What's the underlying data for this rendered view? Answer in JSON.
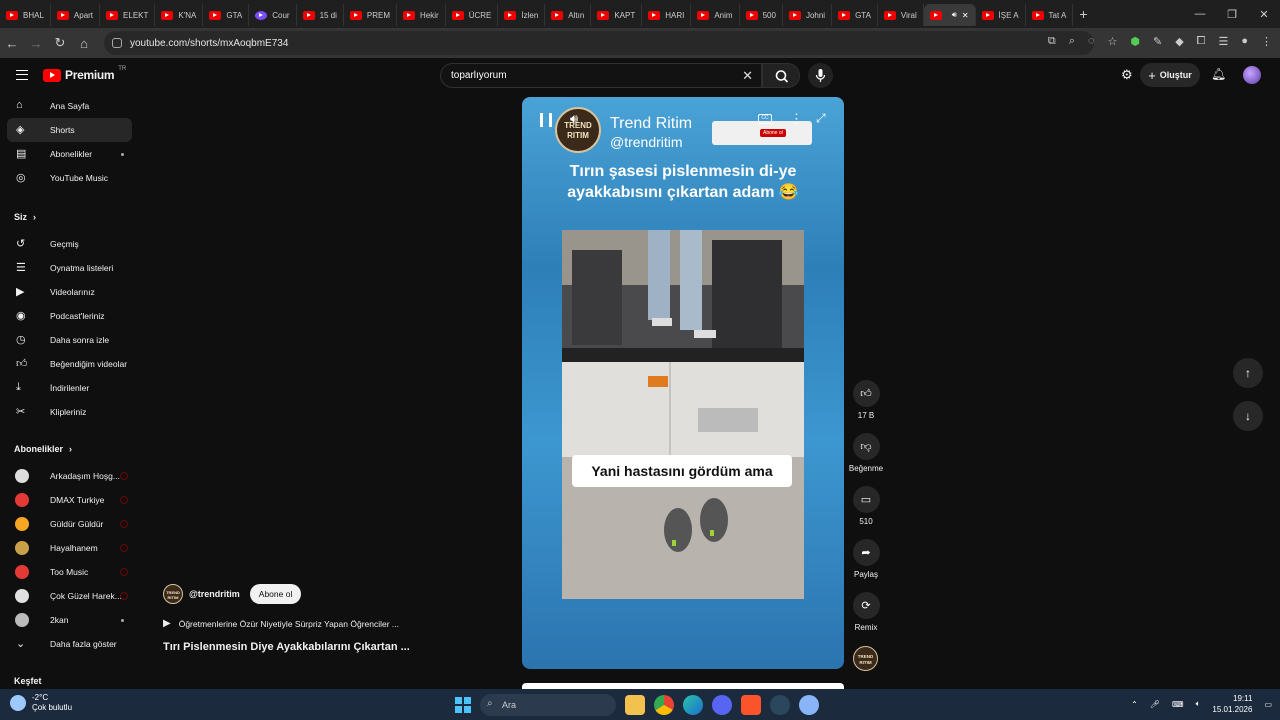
{
  "browser": {
    "tabs": [
      {
        "label": "BHAL",
        "fav": "youtube"
      },
      {
        "label": "Apart",
        "fav": "youtube"
      },
      {
        "label": "ELEKT",
        "fav": "youtube"
      },
      {
        "label": "K'NA",
        "fav": "youtube"
      },
      {
        "label": "GTA",
        "fav": "youtube"
      },
      {
        "label": "Cour",
        "fav": "other"
      },
      {
        "label": "15 di",
        "fav": "youtube"
      },
      {
        "label": "PREM",
        "fav": "youtube"
      },
      {
        "label": "Hekir",
        "fav": "youtube"
      },
      {
        "label": "ÜCRE",
        "fav": "youtube"
      },
      {
        "label": "İzlen",
        "fav": "youtube"
      },
      {
        "label": "Altın",
        "fav": "youtube"
      },
      {
        "label": "KAPT",
        "fav": "youtube"
      },
      {
        "label": "HARI",
        "fav": "youtube"
      },
      {
        "label": "Anim",
        "fav": "youtube"
      },
      {
        "label": "500",
        "fav": "youtube"
      },
      {
        "label": "Johni",
        "fav": "youtube"
      },
      {
        "label": "GTA",
        "fav": "youtube"
      },
      {
        "label": "Viral",
        "fav": "youtube"
      },
      {
        "label": "",
        "fav": "youtube",
        "active": true
      },
      {
        "label": "İŞE A",
        "fav": "youtube"
      },
      {
        "label": "Tat A",
        "fav": "youtube"
      }
    ],
    "url": "youtube.com/shorts/mxAoqbmE734"
  },
  "header": {
    "logo_word": "Premium",
    "logo_region": "TR",
    "search_value": "toparlıyorum",
    "create_label": "Oluştur"
  },
  "sidebar": {
    "main": [
      {
        "label": "Ana Sayfa",
        "icon": "home-icon"
      },
      {
        "label": "Shorts",
        "icon": "shorts-icon",
        "active": true
      },
      {
        "label": "Abonelikler",
        "icon": "subscriptions-icon",
        "dot": true
      },
      {
        "label": "YouTube Music",
        "icon": "music-icon"
      }
    ],
    "you_title": "Siz",
    "you": [
      {
        "label": "Geçmiş",
        "icon": "history-icon"
      },
      {
        "label": "Oynatma listeleri",
        "icon": "playlists-icon"
      },
      {
        "label": "Videolarınız",
        "icon": "your-videos-icon"
      },
      {
        "label": "Podcast'leriniz",
        "icon": "podcast-icon"
      },
      {
        "label": "Daha sonra izle",
        "icon": "watch-later-icon"
      },
      {
        "label": "Beğendiğim videolar",
        "icon": "liked-icon"
      },
      {
        "label": "İndirilenler",
        "icon": "download-icon"
      },
      {
        "label": "Klipleriniz",
        "icon": "clips-icon"
      }
    ],
    "subs_title": "Abonelikler",
    "subs": [
      {
        "label": "Arkadaşım Hoşg...",
        "color": "#ddd",
        "live": true
      },
      {
        "label": "DMAX Turkiye",
        "color": "#e53935",
        "live": true
      },
      {
        "label": "Güldür Güldür",
        "color": "#f5a623",
        "live": true
      },
      {
        "label": "Hayalhanem",
        "color": "#c8a04a",
        "live": true
      },
      {
        "label": "Too Music",
        "color": "#e53935",
        "live": true
      },
      {
        "label": "Çok Güzel Harek...",
        "color": "#e0e0e0",
        "live": true
      },
      {
        "label": "2kan",
        "color": "#bbb",
        "dot": true
      }
    ],
    "more_label": "Daha fazla göster",
    "explore_title": "Keşfet"
  },
  "short": {
    "channel_name": "Trend Ritim",
    "channel_handle": "@trendritim",
    "logo_text": "TREND RITIM",
    "overlay_title": "Tırın şasesi pislenmesin di-ye ayakkabısını çıkartan adam 😂",
    "caption": "Yani hastasını gördüm ama",
    "subscribe_badge": "Abone ol"
  },
  "actions": [
    {
      "icon": "like-icon",
      "label": "17 B"
    },
    {
      "icon": "dislike-icon",
      "label": "Beğenme"
    },
    {
      "icon": "comment-icon",
      "label": "510"
    },
    {
      "icon": "share-icon",
      "label": "Paylaş"
    },
    {
      "icon": "remix-icon",
      "label": "Remix"
    }
  ],
  "info": {
    "handle": "@trendritim",
    "subscribe": "Abone ol",
    "related": "Öğretmenlerine Özür Niyetiyle Sürpriz Yapan Öğrenciler ...",
    "title": "Tırı Pislenmesin Diye Ayakkabılarını Çıkartan ..."
  },
  "taskbar": {
    "temp": "-2°C",
    "weather": "Çok bulutlu",
    "search": "Ara",
    "time": "19:11",
    "date": "15.01.2026"
  }
}
